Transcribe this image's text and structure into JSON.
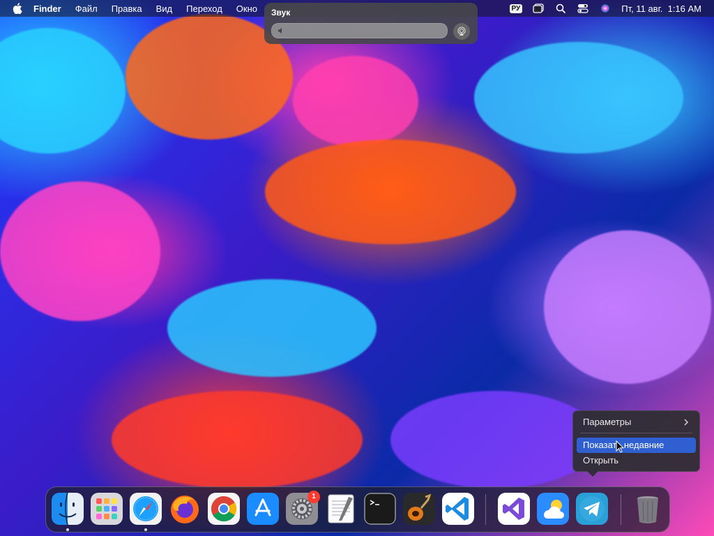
{
  "menubar": {
    "items": [
      "Finder",
      "Файл",
      "Правка",
      "Вид",
      "Переход",
      "Окно"
    ],
    "input_source": "РУ",
    "datetime": "Пт, 11 авг.  1:16 AM"
  },
  "sound_popup": {
    "title": "Звук",
    "volume_level_percent": 0
  },
  "context_menu": {
    "items": [
      {
        "label": "Параметры",
        "submenu": true
      },
      {
        "label": "Показать недавние",
        "highlighted": true
      },
      {
        "label": "Открыть"
      }
    ]
  },
  "dock": {
    "apps": [
      {
        "name": "finder",
        "running": true
      },
      {
        "name": "launchpad",
        "running": false
      },
      {
        "name": "safari",
        "running": true
      },
      {
        "name": "firefox",
        "running": false
      },
      {
        "name": "chrome",
        "running": false
      },
      {
        "name": "app-store",
        "running": false
      },
      {
        "name": "system-settings",
        "running": false,
        "badge": "1"
      },
      {
        "name": "textedit",
        "running": false
      },
      {
        "name": "terminal",
        "running": false
      },
      {
        "name": "garageband",
        "running": false
      },
      {
        "name": "vscode",
        "running": false
      },
      {
        "name": "visual-studio",
        "running": false
      },
      {
        "name": "weather",
        "running": false
      },
      {
        "name": "telegram",
        "running": false
      },
      {
        "name": "trash",
        "running": false
      }
    ]
  }
}
